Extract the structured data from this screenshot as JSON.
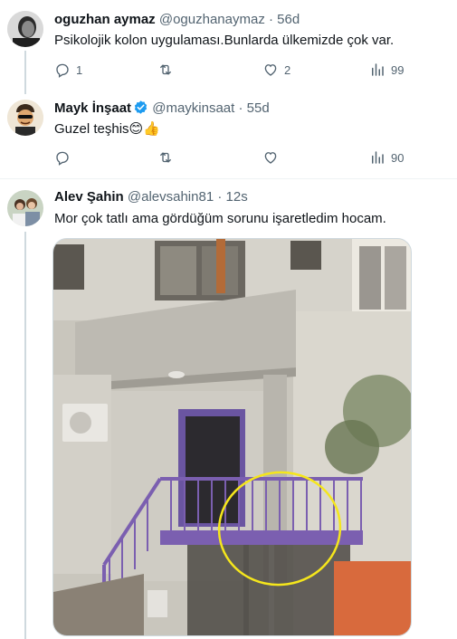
{
  "tweets": [
    {
      "name": "oguzhan aymaz",
      "handle": "@oguzhanaymaz",
      "separator": "·",
      "time": "56d",
      "text": "Psikolojik kolon uygulaması.Bunlarda ülkemizde çok var.",
      "replies": "1",
      "retweets": "",
      "likes": "2",
      "views": "99"
    },
    {
      "name": "Mayk İnşaat",
      "handle": "@maykinsaat",
      "separator": "·",
      "time": "55d",
      "text": "Guzel teşhis",
      "emojis": "😊👍",
      "verified": true,
      "replies": "",
      "retweets": "",
      "likes": "",
      "views": "90"
    },
    {
      "name": "Alev Şahin",
      "handle": "@alevsahin81",
      "separator": "·",
      "time": "12s",
      "text": "Mor çok tatlı ama gördüğüm sorunu işaretledim hocam."
    }
  ],
  "colors": {
    "text_primary": "#0f1419",
    "text_secondary": "#536471",
    "verified_blue": "#1d9bf0",
    "annotation_yellow": "#f5e61c",
    "railing_purple": "#7b5fb0"
  }
}
